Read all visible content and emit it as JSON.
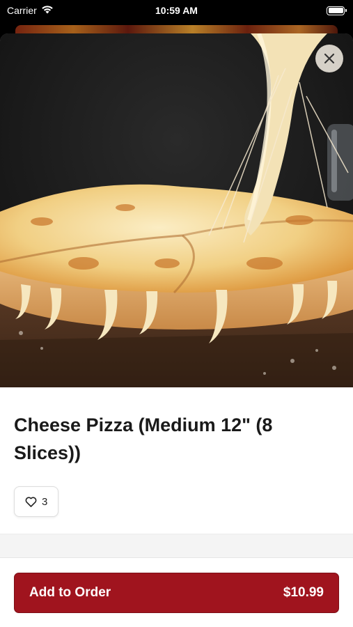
{
  "status_bar": {
    "carrier": "Carrier",
    "time": "10:59 AM"
  },
  "item": {
    "name": "Cheese Pizza (Medium 12\" (8 Slices))",
    "like_count": "3",
    "image": "cheese-pizza-photo"
  },
  "footer": {
    "add_label": "Add to Order",
    "price": "$10.99"
  },
  "colors": {
    "accent": "#a0141e",
    "text": "#1a1a1a"
  },
  "icons": [
    "wifi-icon",
    "battery-icon",
    "close-icon",
    "heart-icon"
  ]
}
